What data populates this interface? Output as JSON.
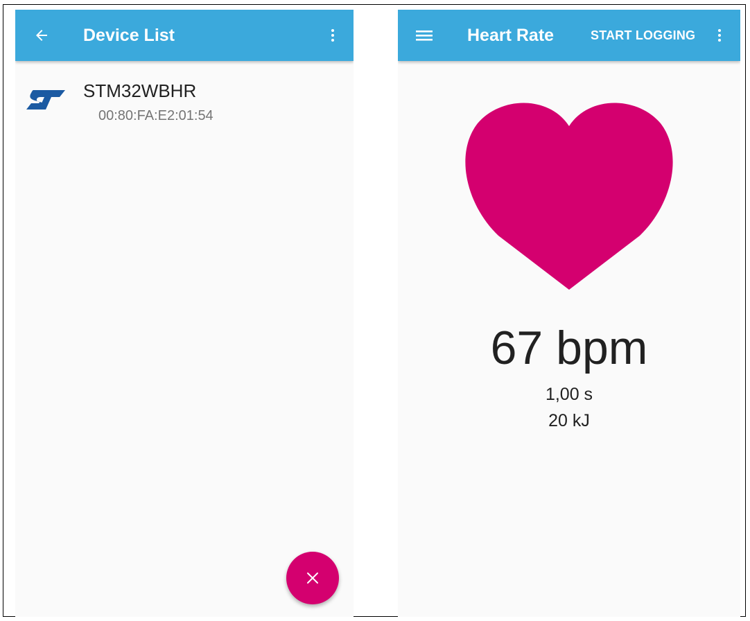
{
  "colors": {
    "appbar": "#3ba9dc",
    "accent": "#d4006f",
    "background": "#fafafa"
  },
  "device_list_screen": {
    "appbar": {
      "title": "Device List",
      "back_icon": "arrow-back-icon",
      "menu_icon": "more-vert-icon"
    },
    "devices": [
      {
        "logo": "st-logo-icon",
        "name": "STM32WBHR",
        "address": "00:80:FA:E2:01:54"
      }
    ],
    "fab": {
      "icon": "close-icon",
      "label": "×"
    }
  },
  "heart_rate_screen": {
    "appbar": {
      "title": "Heart Rate",
      "action_label": "START LOGGING",
      "nav_icon": "hamburger-menu-icon",
      "menu_icon": "more-vert-icon"
    },
    "heart_icon": "heart-icon",
    "bpm": "67 bpm",
    "rr_interval": "1,00 s",
    "energy": "20 kJ"
  }
}
